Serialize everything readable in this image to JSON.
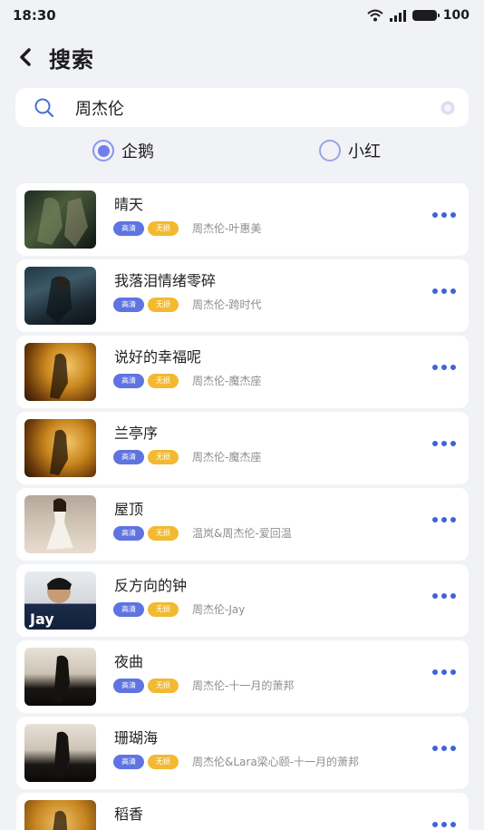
{
  "status": {
    "time": "18:30",
    "battery": "100"
  },
  "header": {
    "title": "搜索"
  },
  "search": {
    "value": "周杰伦",
    "placeholder": ""
  },
  "sources": [
    {
      "label": "企鹅",
      "checked": true
    },
    {
      "label": "小红",
      "checked": false
    }
  ],
  "tags": {
    "hq": "高清",
    "lossless": "无损"
  },
  "songs": [
    {
      "title": "晴天",
      "meta": "周杰伦-叶惠美"
    },
    {
      "title": "我落泪情绪零碎",
      "meta": "周杰伦-跨时代"
    },
    {
      "title": "说好的幸福呢",
      "meta": "周杰伦-魔杰座"
    },
    {
      "title": "兰亭序",
      "meta": "周杰伦-魔杰座"
    },
    {
      "title": "屋顶",
      "meta": "温岚&周杰伦-爱回温"
    },
    {
      "title": "反方向的钟",
      "meta": "周杰伦-Jay"
    },
    {
      "title": "夜曲",
      "meta": "周杰伦-十一月的萧邦"
    },
    {
      "title": "珊瑚海",
      "meta": "周杰伦&Lara梁心颐-十一月的萧邦"
    },
    {
      "title": "稻香",
      "meta": ""
    }
  ],
  "cover_texts": {
    "jay": "Jay"
  },
  "colors": {
    "accent": "#5f74e0",
    "lossless": "#f2b931",
    "dots": "#3f63d8"
  }
}
